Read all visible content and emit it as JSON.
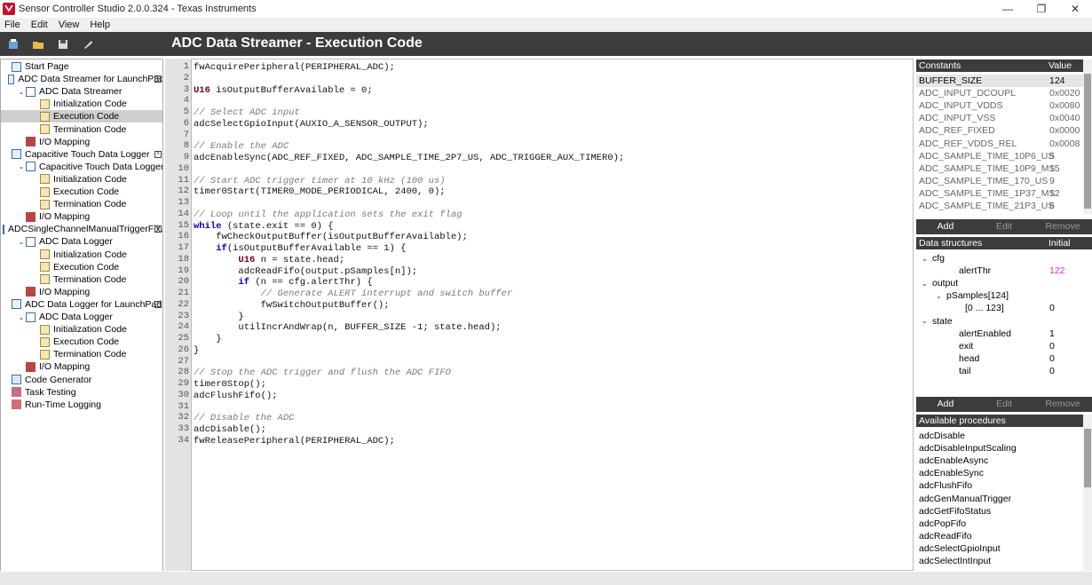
{
  "window": {
    "title": "Sensor Controller Studio 2.0.0.324 - Texas Instruments",
    "minimize": "—",
    "maximize": "❐",
    "close": "✕"
  },
  "menu": [
    "File",
    "Edit",
    "View",
    "Help"
  ],
  "toolbar_icons": [
    "new-project-icon",
    "open-project-icon",
    "save-icon",
    "build-icon"
  ],
  "page_title": "ADC Data Streamer - Execution Code",
  "tree": [
    {
      "label": "Start Page",
      "level": 0,
      "icon": "page",
      "chev": "",
      "closable": false,
      "selected": false
    },
    {
      "label": "ADC Data Streamer for LaunchPad",
      "level": 0,
      "icon": "page",
      "chev": "",
      "closable": true,
      "selected": false
    },
    {
      "label": "ADC Data Streamer",
      "level": 1,
      "icon": "doc",
      "chev": "⌄",
      "closable": false,
      "selected": false
    },
    {
      "label": "Initialization Code",
      "level": 2,
      "icon": "code",
      "chev": "",
      "closable": false,
      "selected": false
    },
    {
      "label": "Execution Code",
      "level": 2,
      "icon": "code",
      "chev": "",
      "closable": false,
      "selected": true
    },
    {
      "label": "Termination Code",
      "level": 2,
      "icon": "code",
      "chev": "",
      "closable": false,
      "selected": false
    },
    {
      "label": "I/O Mapping",
      "level": 1,
      "icon": "io",
      "chev": "",
      "closable": false,
      "selected": false
    },
    {
      "label": "Capacitive Touch Data Logger",
      "level": 0,
      "icon": "page",
      "chev": "",
      "closable": true,
      "selected": false
    },
    {
      "label": "Capacitive Touch Data Logger",
      "level": 1,
      "icon": "doc",
      "chev": "⌄",
      "closable": false,
      "selected": false
    },
    {
      "label": "Initialization Code",
      "level": 2,
      "icon": "code",
      "chev": "",
      "closable": false,
      "selected": false
    },
    {
      "label": "Execution Code",
      "level": 2,
      "icon": "code",
      "chev": "",
      "closable": false,
      "selected": false
    },
    {
      "label": "Termination Code",
      "level": 2,
      "icon": "code",
      "chev": "",
      "closable": false,
      "selected": false
    },
    {
      "label": "I/O Mapping",
      "level": 1,
      "icon": "io",
      "chev": "",
      "closable": false,
      "selected": false
    },
    {
      "label": "ADCSingleChannelManualTriggerFix...",
      "level": 0,
      "icon": "page",
      "chev": "",
      "closable": true,
      "selected": false
    },
    {
      "label": "ADC Data Logger",
      "level": 1,
      "icon": "doc",
      "chev": "⌄",
      "closable": false,
      "selected": false
    },
    {
      "label": "Initialization Code",
      "level": 2,
      "icon": "code",
      "chev": "",
      "closable": false,
      "selected": false
    },
    {
      "label": "Execution Code",
      "level": 2,
      "icon": "code",
      "chev": "",
      "closable": false,
      "selected": false
    },
    {
      "label": "Termination Code",
      "level": 2,
      "icon": "code",
      "chev": "",
      "closable": false,
      "selected": false
    },
    {
      "label": "I/O Mapping",
      "level": 1,
      "icon": "io",
      "chev": "",
      "closable": false,
      "selected": false
    },
    {
      "label": "ADC Data Logger for LaunchPad",
      "level": 0,
      "icon": "page",
      "chev": "",
      "closable": true,
      "selected": false
    },
    {
      "label": "ADC Data Logger",
      "level": 1,
      "icon": "doc",
      "chev": "⌄",
      "closable": false,
      "selected": false
    },
    {
      "label": "Initialization Code",
      "level": 2,
      "icon": "code",
      "chev": "",
      "closable": false,
      "selected": false
    },
    {
      "label": "Execution Code",
      "level": 2,
      "icon": "code",
      "chev": "",
      "closable": false,
      "selected": false
    },
    {
      "label": "Termination Code",
      "level": 2,
      "icon": "code",
      "chev": "",
      "closable": false,
      "selected": false
    },
    {
      "label": "I/O Mapping",
      "level": 1,
      "icon": "io",
      "chev": "",
      "closable": false,
      "selected": false
    },
    {
      "label": "Code Generator",
      "level": 0,
      "icon": "gen",
      "chev": "",
      "closable": false,
      "selected": false
    },
    {
      "label": "Task Testing",
      "level": 0,
      "icon": "test",
      "chev": "",
      "closable": false,
      "selected": false
    },
    {
      "label": "Run-Time Logging",
      "level": 0,
      "icon": "log",
      "chev": "",
      "closable": false,
      "selected": false
    }
  ],
  "code_lines": [
    "fwAcquirePeripheral(PERIPHERAL_ADC);",
    "",
    "U16 isOutputBufferAvailable = 0;",
    "",
    "// Select ADC input",
    "adcSelectGpioInput(AUXIO_A_SENSOR_OUTPUT);",
    "",
    "// Enable the ADC",
    "adcEnableSync(ADC_REF_FIXED, ADC_SAMPLE_TIME_2P7_US, ADC_TRIGGER_AUX_TIMER0);",
    "",
    "// Start ADC trigger timer at 10 kHz (100 us)",
    "timer0Start(TIMER0_MODE_PERIODICAL, 2400, 0);",
    "",
    "// Loop until the application sets the exit flag",
    "while (state.exit == 0) {",
    "    fwCheckOutputBuffer(isOutputBufferAvailable);",
    "    if(isOutputBufferAvailable == 1) {",
    "        U16 n = state.head;",
    "        adcReadFifo(output.pSamples[n]);",
    "        if (n == cfg.alertThr) {",
    "            // Generate ALERT interrupt and switch buffer",
    "            fwSwitchOutputBuffer();",
    "        }",
    "        utilIncrAndWrap(n, BUFFER_SIZE -1; state.head);",
    "    }",
    "}",
    "",
    "// Stop the ADC trigger and flush the ADC FIFO",
    "timer0Stop();",
    "adcFlushFifo();",
    "",
    "// Disable the ADC",
    "adcDisable();",
    "fwReleasePeripheral(PERIPHERAL_ADC);"
  ],
  "constants": {
    "header_name": "Constants",
    "header_value": "Value",
    "rows": [
      {
        "name": "BUFFER_SIZE",
        "value": "124",
        "dim": false
      },
      {
        "name": "ADC_INPUT_DCOUPL",
        "value": "0x0020",
        "dim": true
      },
      {
        "name": "ADC_INPUT_VDDS",
        "value": "0x0080",
        "dim": true
      },
      {
        "name": "ADC_INPUT_VSS",
        "value": "0x0040",
        "dim": true
      },
      {
        "name": "ADC_REF_FIXED",
        "value": "0x0000",
        "dim": true
      },
      {
        "name": "ADC_REF_VDDS_REL",
        "value": "0x0008",
        "dim": true
      },
      {
        "name": "ADC_SAMPLE_TIME_10P6_US",
        "value": "5",
        "dim": true
      },
      {
        "name": "ADC_SAMPLE_TIME_10P9_MS",
        "value": "15",
        "dim": true
      },
      {
        "name": "ADC_SAMPLE_TIME_170_US",
        "value": "9",
        "dim": true
      },
      {
        "name": "ADC_SAMPLE_TIME_1P37_MS",
        "value": "12",
        "dim": true
      },
      {
        "name": "ADC_SAMPLE_TIME_21P3_US",
        "value": "6",
        "dim": true
      }
    ],
    "buttons": [
      "Add",
      "Edit",
      "Remove"
    ]
  },
  "data_structures": {
    "header_name": "Data structures",
    "header_value": "Initial",
    "rows": [
      {
        "name": "cfg",
        "value": "",
        "level": 0,
        "chev": "⌄",
        "value_color": "#000000"
      },
      {
        "name": "alertThr",
        "value": "122",
        "level": 1,
        "chev": "",
        "value_color": "#cc33cc"
      },
      {
        "name": "output",
        "value": "",
        "level": 0,
        "chev": "⌄",
        "value_color": "#000000"
      },
      {
        "name": "pSamples[124]",
        "value": "",
        "level": 1,
        "chev": "⌄",
        "value_color": "#000000"
      },
      {
        "name": "[0 ... 123]",
        "value": "0",
        "level": 2,
        "chev": "",
        "value_color": "#000000"
      },
      {
        "name": "state",
        "value": "",
        "level": 0,
        "chev": "⌄",
        "value_color": "#000000"
      },
      {
        "name": "alertEnabled",
        "value": "1",
        "level": 1,
        "chev": "",
        "value_color": "#000000"
      },
      {
        "name": "exit",
        "value": "0",
        "level": 1,
        "chev": "",
        "value_color": "#000000"
      },
      {
        "name": "head",
        "value": "0",
        "level": 1,
        "chev": "",
        "value_color": "#000000"
      },
      {
        "name": "tail",
        "value": "0",
        "level": 1,
        "chev": "",
        "value_color": "#000000"
      }
    ],
    "buttons": [
      "Add",
      "Edit",
      "Remove"
    ]
  },
  "procedures": {
    "header": "Available procedures",
    "items": [
      "adcDisable",
      "adcDisableInputScaling",
      "adcEnableAsync",
      "adcEnableSync",
      "adcFlushFifo",
      "adcGenManualTrigger",
      "adcGetFifoStatus",
      "adcPopFifo",
      "adcReadFifo",
      "adcSelectGpioInput",
      "adcSelectIntInput"
    ]
  },
  "colors": {
    "dark_header": "#3c3c3c",
    "keyword": "#0000cc",
    "type": "#7a0020",
    "comment": "#7a7a7a",
    "selected_tree": "#cfcfcf"
  }
}
